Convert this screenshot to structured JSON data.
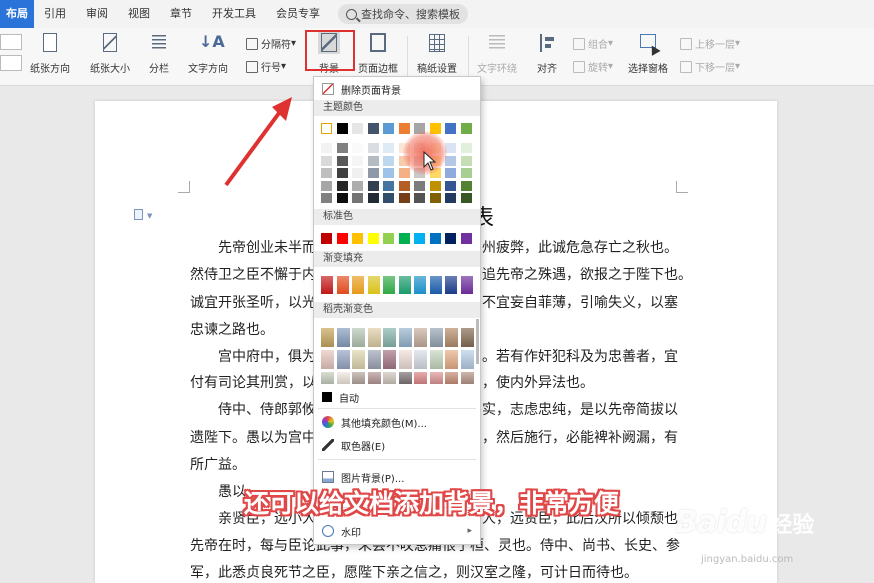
{
  "tabs": {
    "active": "布局",
    "items": [
      "引用",
      "审阅",
      "视图",
      "章节",
      "开发工具",
      "会员专享"
    ],
    "search_label": "查找命令、搜索模板"
  },
  "ribbon": {
    "paper_direction": "纸张方向",
    "paper_size": "纸张大小",
    "columns": "分栏",
    "text_direction": "文字方向",
    "separator": "分隔符",
    "line_numbers": "行号",
    "background": "背景",
    "page_border": "页面边框",
    "paper_setup": "稿纸设置",
    "text_wrap": "文字环绕",
    "align": "对齐",
    "group": "组合",
    "rotate": "旋转",
    "select_pane": "选择窗格",
    "bring_forward": "上移一层",
    "send_backward": "下移一层"
  },
  "dropdown": {
    "remove_background": "删除页面背景",
    "theme_colors": "主题颜色",
    "standard_colors": "标准色",
    "gradient_fill": "渐变填充",
    "dao_gradient": "稻壳渐变色",
    "auto": "自动",
    "more_fill_colors": "其他填充颜色(M)...",
    "eyedropper": "取色器(E)",
    "picture_background": "图片背景(P)...",
    "watermark": "水印",
    "theme_top_row": [
      "#ffffff",
      "#000000",
      "#e7e6e6",
      "#44546a",
      "#5b9bd5",
      "#ed7d31",
      "#a5a5a5",
      "#ffc000",
      "#4472c4",
      "#70ad47"
    ],
    "standard_row": [
      "#c00000",
      "#ff0000",
      "#ffc000",
      "#ffff00",
      "#92d050",
      "#00b050",
      "#00b0f0",
      "#0070c0",
      "#002060",
      "#7030a0"
    ],
    "gradient_row": [
      "#c01818",
      "#e04a1a",
      "#e69a1a",
      "#d9c21a",
      "#2ea844",
      "#1a9a6a",
      "#1a8fc8",
      "#1a5aa8",
      "#1a3a8a",
      "#6a2a98"
    ]
  },
  "document": {
    "title": "表",
    "lines": [
      "先帝创业未半而",
      "州疲弊，此诚危急存亡之秋也。",
      "然侍卫之臣不懈于内",
      "追先帝之殊遇，欲报之于陛下也。",
      "诚宜开张圣听，以光",
      "不宜妄自菲薄，引喻失义，以塞",
      "忠谏之路也。",
      "宫中府中，俱为",
      "。若有作奸犯科及为忠善者，宜",
      "付有司论其刑赏，以",
      "，使内外异法也。",
      "侍中、侍郎郭攸",
      "实，志虑忠纯，是以先帝简拔以",
      "遗陛下。愚以为宫中",
      "，然后施行，必能裨补阙漏，有",
      "所广益。",
      "愚以",
      "亲贤臣，远小人",
      "人，远贤臣，此后汉所以倾颓也。",
      "先帝在时，每与臣论此事，未尝不叹息痛恨于桓、灵也。侍中、尚书、长史、参",
      "军，此悉贞良死节之臣，愿陛下亲之信之，则汉室之隆，可计日而待也。"
    ]
  },
  "caption": "还可以给文档添加背景，非常方便",
  "watermark": {
    "logo": "Baidu",
    "cn": "经验",
    "url": "jingyan.baidu.com"
  }
}
